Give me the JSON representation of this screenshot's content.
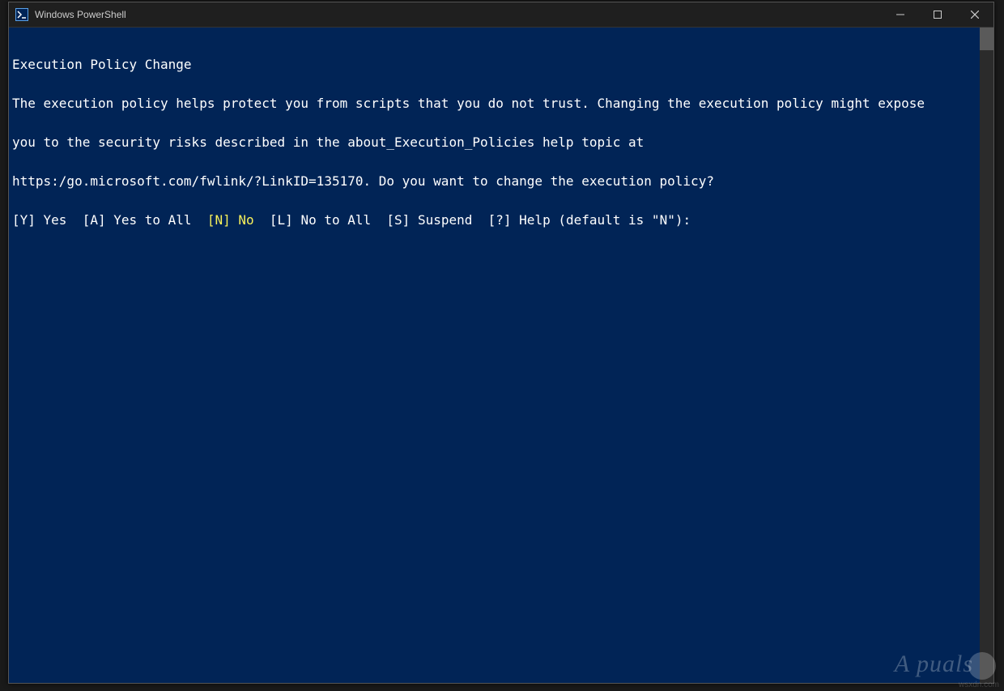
{
  "window": {
    "title": "Windows PowerShell"
  },
  "console": {
    "heading": "Execution Policy Change",
    "body_line1": "The execution policy helps protect you from scripts that you do not trust. Changing the execution policy might expose",
    "body_line2": "you to the security risks described in the about_Execution_Policies help topic at",
    "body_line3": "https:/go.microsoft.com/fwlink/?LinkID=135170. Do you want to change the execution policy?",
    "prompt": {
      "opt_yes": "[Y] Yes  ",
      "opt_yes_all": "[A] Yes to All  ",
      "opt_no_key": "[N]",
      "opt_no_label": " No",
      "opt_sep1": "  ",
      "opt_no_all": "[L] No to All  ",
      "opt_suspend": "[S] Suspend  ",
      "opt_help": "[?] Help (default is \"N\"):"
    }
  },
  "watermark": {
    "text": "A  puals",
    "source": "wsxdn.com"
  }
}
